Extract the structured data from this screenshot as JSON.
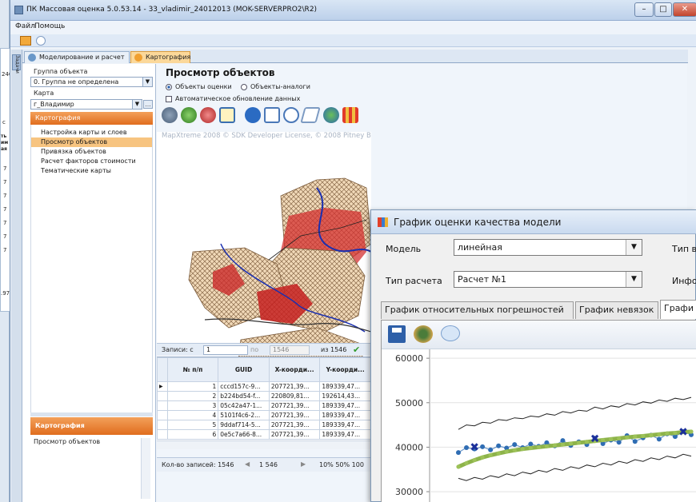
{
  "window": {
    "title": "ПК Массовая оценка 5.0.53.14 - 33_vladimir_24012013 (MOK-SERVERPRO2\\R2)",
    "menu": [
      "Файл",
      "Помощь"
    ]
  },
  "background_fragments": {
    "left_texts": [
      "246",
      "с",
      "ть",
      "им",
      "ая",
      "7",
      "7",
      "7",
      "7",
      "7",
      "7",
      "7",
      ".97"
    ]
  },
  "side_strip_label": "Задачи",
  "tabs": [
    {
      "label": "Моделирование и расчет",
      "active": false
    },
    {
      "label": "Картография",
      "active": true
    }
  ],
  "left_panel": {
    "group_label": "Группа объекта",
    "group_value": "0. Группа не определена",
    "map_label": "Карта",
    "map_value": "г_Владимир",
    "nav_header": "Картография",
    "nav_items": [
      {
        "label": "Настройка карты и слоев",
        "selected": false
      },
      {
        "label": "Просмотр объектов",
        "selected": true
      },
      {
        "label": "Привязка объектов",
        "selected": false
      },
      {
        "label": "Расчет факторов стоимости",
        "selected": false
      },
      {
        "label": "Тематические карты",
        "selected": false
      }
    ],
    "bottom_header": "Картография",
    "bottom_item": "Просмотр объектов"
  },
  "view": {
    "title": "Просмотр объектов",
    "radio_objects": "Объекты оценки",
    "radio_analogs": "Объекты-аналоги",
    "radio_selected": "objects",
    "auto_update_label": "Автоматическое обновление данных",
    "auto_update_checked": false,
    "watermark": "MapXtreme 2008 © SDK Developer License, © 2008 Pitney Bowes MapInfo Corporation."
  },
  "records_bar": {
    "label": "Записи: с",
    "from": "1",
    "po": "по",
    "to": "1546",
    "of": "из 1546"
  },
  "grid": {
    "headers": [
      "№ п/п",
      "GUID",
      "X-коорди...",
      "Y-коорди..."
    ],
    "rows": [
      [
        "1",
        "cccd157c-9...",
        "207721,39...",
        "189339,47..."
      ],
      [
        "2",
        "b224bd54-f...",
        "220809,81...",
        "192614,43..."
      ],
      [
        "3",
        "05c42a47-1...",
        "207721,39...",
        "189339,47..."
      ],
      [
        "4",
        "5101f4c6-2...",
        "207721,39...",
        "189339,47..."
      ],
      [
        "5",
        "9ddaf714-5...",
        "207721,39...",
        "189339,47..."
      ],
      [
        "6",
        "0e5c7a66-8...",
        "207721,39...",
        "189339,47..."
      ]
    ],
    "status": "Кол-во записей: 1546",
    "page_value": "1 546",
    "zoom_options": "10%  50%  100"
  },
  "dialog": {
    "title": "График оценки качества модели",
    "model_label": "Модель",
    "model_value": "линейная",
    "type_label": "Тип в",
    "calc_type_label": "Тип расчета",
    "calc_type_value": "Расчет №1",
    "info_label": "Инфо",
    "tabs": [
      "График относительных погрешностей",
      "График невязок",
      "Графи"
    ],
    "active_tab": 2
  },
  "chart_data": {
    "type": "line",
    "ylim": [
      27500,
      62000
    ],
    "yticks": [
      30000,
      40000,
      50000,
      60000
    ],
    "ytick_labels": [
      "30000",
      "40000",
      "50000",
      "60000"
    ],
    "x": [
      1,
      2,
      3,
      4,
      5,
      6,
      7,
      8,
      9,
      10,
      11,
      12,
      13,
      14,
      15,
      16,
      17,
      18,
      19,
      20,
      21,
      22,
      23,
      24,
      25,
      26,
      27,
      28,
      29,
      30
    ],
    "series": [
      {
        "values": [
          38800,
          39900,
          39600,
          40100,
          39400,
          40300,
          39800,
          40600,
          39900,
          40700,
          40200,
          41000,
          40300,
          41500,
          40400,
          41200,
          40600,
          42000,
          40800,
          41600,
          41100,
          42600,
          41300,
          42100,
          42700,
          41800,
          43000,
          42400,
          43500,
          42800
        ],
        "color": "#2f6db3"
      },
      {
        "values": [
          35600,
          36400,
          37100,
          37700,
          38200,
          38600,
          39000,
          39300,
          39600,
          39800,
          40000,
          40200,
          40400,
          40600,
          40800,
          41000,
          41200,
          41400,
          41600,
          41800,
          42000,
          42200,
          42400,
          42500,
          42700,
          42900,
          43100,
          43200,
          43400,
          43500
        ],
        "color": "#8db34a"
      },
      {
        "values": [
          44000,
          45000,
          44800,
          45600,
          45400,
          46200,
          46000,
          46600,
          46400,
          47000,
          46800,
          47500,
          47200,
          48000,
          47700,
          48300,
          48100,
          49000,
          48600,
          49300,
          49000,
          49800,
          49500,
          50200,
          49900,
          50600,
          50300,
          51000,
          50700,
          51200
        ],
        "color": "#222222"
      },
      {
        "values": [
          33000,
          32500,
          33200,
          32800,
          33600,
          33200,
          34000,
          33600,
          34400,
          34000,
          34800,
          34400,
          35200,
          34800,
          35600,
          35200,
          36000,
          35600,
          36400,
          36000,
          36800,
          36400,
          37200,
          36800,
          37600,
          37200,
          38000,
          37600,
          38400,
          38000
        ],
        "color": "#222222"
      }
    ],
    "markers_x": [
      3,
      18,
      29
    ],
    "markers_y": [
      40100,
      42000,
      43500
    ]
  }
}
